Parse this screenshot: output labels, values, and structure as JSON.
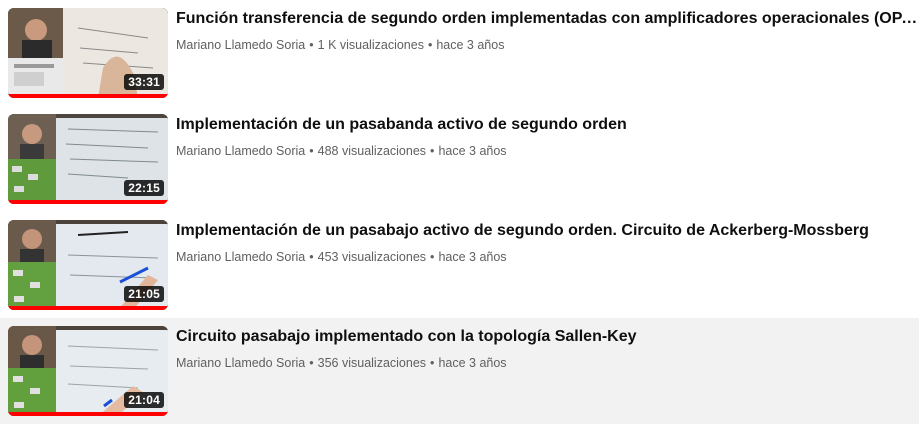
{
  "videos": [
    {
      "title": "Función transferencia de segundo orden implementadas con amplificadores operacionales (OPAMP's)",
      "channel": "Mariano Llamedo Soria",
      "views": "1 K visualizaciones",
      "age": "hace 3 años",
      "duration": "33:31",
      "watched_fraction": 1.0
    },
    {
      "title": "Implementación de un pasabanda activo de segundo orden",
      "channel": "Mariano Llamedo Soria",
      "views": "488 visualizaciones",
      "age": "hace 3 años",
      "duration": "22:15",
      "watched_fraction": 1.0
    },
    {
      "title": "Implementación de un pasabajo activo de segundo orden. Circuito de Ackerberg-Mossberg",
      "channel": "Mariano Llamedo Soria",
      "views": "453 visualizaciones",
      "age": "hace 3 años",
      "duration": "21:05",
      "watched_fraction": 1.0
    },
    {
      "title": "Circuito pasabajo implementado con la topología Sallen-Key",
      "channel": "Mariano Llamedo Soria",
      "views": "356 visualizaciones",
      "age": "hace 3 años",
      "duration": "21:04",
      "watched_fraction": 1.0
    }
  ],
  "separator": "•",
  "colors": {
    "progress": "#ff0000",
    "hover_row": "#f2f2f2",
    "title": "#0f0f0f",
    "meta": "#606060"
  }
}
